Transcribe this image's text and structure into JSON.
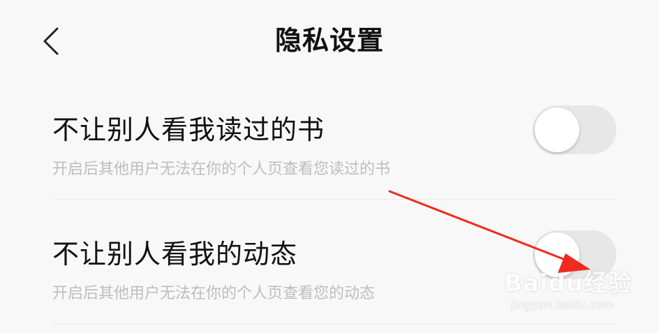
{
  "header": {
    "title": "隐私设置",
    "back_icon": "chevron-left-icon"
  },
  "settings": [
    {
      "title": "不让别人看我读过的书",
      "description": "开启后其他用户无法在你的个人页查看您读过的书",
      "enabled": false
    },
    {
      "title": "不让别人看我的动态",
      "description": "开启后其他用户无法在你的个人页查看您的动态",
      "enabled": false
    }
  ],
  "annotation": {
    "color": "#f02a1e"
  },
  "watermark": {
    "logo": "Baidu经验",
    "url": "jingyan.baidu.com"
  },
  "colors": {
    "background": "#f8f8f8",
    "toggle_off": "#e7e7e7",
    "text_primary": "#111111",
    "text_secondary": "#bdbdbd"
  }
}
